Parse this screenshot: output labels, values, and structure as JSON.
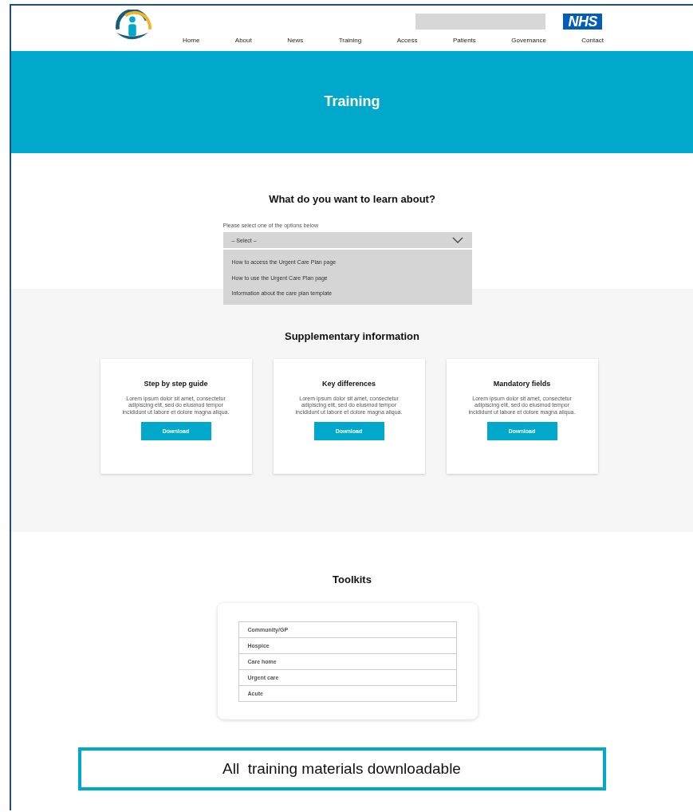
{
  "header": {
    "nhs_badge": "NHS",
    "nav": [
      "Home",
      "About",
      "News",
      "Training",
      "Access",
      "Patients",
      "Governance",
      "Contact"
    ]
  },
  "hero": {
    "title": "Training"
  },
  "learn": {
    "heading": "What do you want to learn about?",
    "label": "Please select one of the options below",
    "select": {
      "value": "– Select –",
      "expanded": true,
      "options": [
        "How to access the Urgent Care Plan page",
        "How to use the Urgent Care Plan page",
        "Information about the care plan template"
      ]
    }
  },
  "supplementary": {
    "heading": "Supplementary information",
    "cards": [
      {
        "title": "Step by step guide",
        "text": "Lorem ipsum dolor sit amet, consectetur adipiscing elit, sed do eiusmod tempor incididunt ut labore et dolore magna aliqua.",
        "button": "Download"
      },
      {
        "title": "Key differences",
        "text": "Lorem ipsum dolor sit amet, consectetur adipiscing elit, sed do eiusmod tempor incididunt ut labore et dolore magna aliqua.",
        "button": "Download"
      },
      {
        "title": "Mandatory fields",
        "text": "Lorem ipsum dolor sit amet, consectetur adipiscing elit, sed do eiusmod tempor incididunt ut labore et dolore magna aliqua.",
        "button": "Download"
      }
    ]
  },
  "toolkits": {
    "heading": "Toolkits",
    "items": [
      "Community/GP",
      "Hospice",
      "Care home",
      "Urgent care",
      "Acute"
    ]
  },
  "callout": "All  training materials downloadable"
}
